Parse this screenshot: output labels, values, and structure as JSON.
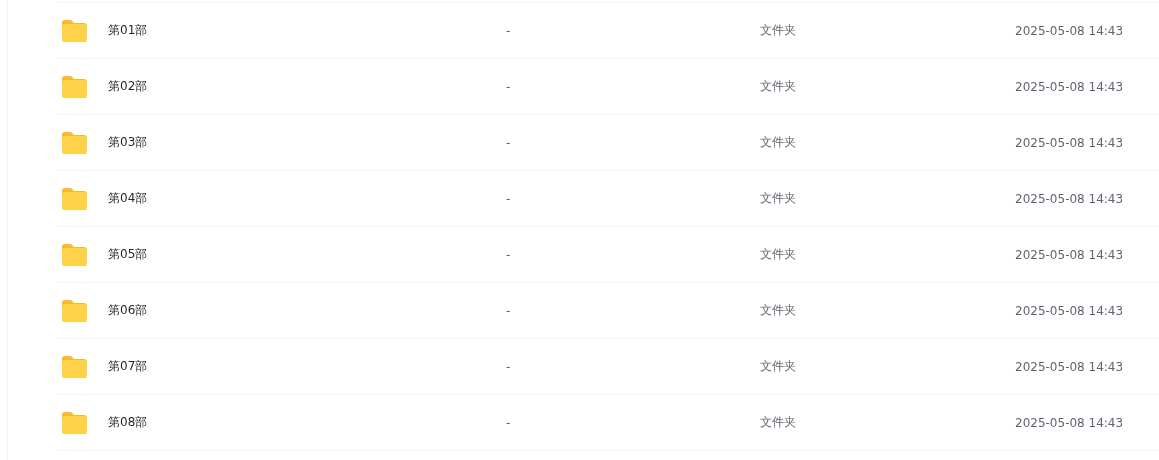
{
  "files": [
    {
      "name": "第01部",
      "size": "-",
      "type": "文件夹",
      "modified": "2025-05-08 14:43"
    },
    {
      "name": "第02部",
      "size": "-",
      "type": "文件夹",
      "modified": "2025-05-08 14:43"
    },
    {
      "name": "第03部",
      "size": "-",
      "type": "文件夹",
      "modified": "2025-05-08 14:43"
    },
    {
      "name": "第04部",
      "size": "-",
      "type": "文件夹",
      "modified": "2025-05-08 14:43"
    },
    {
      "name": "第05部",
      "size": "-",
      "type": "文件夹",
      "modified": "2025-05-08 14:43"
    },
    {
      "name": "第06部",
      "size": "-",
      "type": "文件夹",
      "modified": "2025-05-08 14:43"
    },
    {
      "name": "第07部",
      "size": "-",
      "type": "文件夹",
      "modified": "2025-05-08 14:43"
    },
    {
      "name": "第08部",
      "size": "-",
      "type": "文件夹",
      "modified": "2025-05-08 14:43"
    }
  ]
}
